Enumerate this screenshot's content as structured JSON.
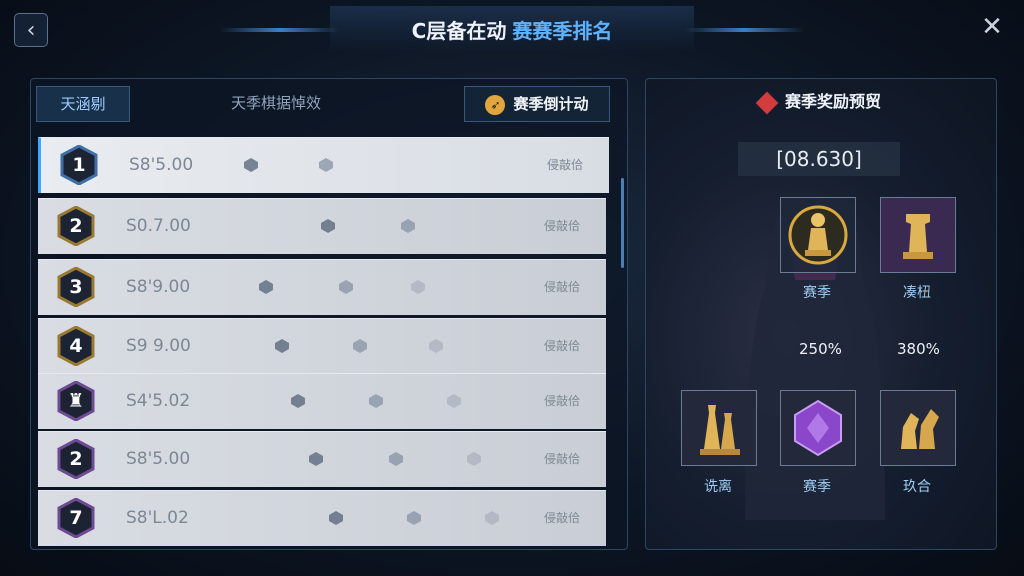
{
  "header": {
    "title_part1": "C层备在动",
    "title_part2": "赛赛季排名",
    "back_icon": "chevron-left-icon",
    "close_icon": "close-icon"
  },
  "tabs": [
    {
      "label": "天涵剔"
    },
    {
      "label": "天季棋据悼效"
    },
    {
      "label": "赛季倒计动",
      "icon": "rocket-icon"
    }
  ],
  "rows": [
    {
      "rank": "1",
      "score": "S8'5.00",
      "tag": "侵敲佮",
      "badge_color": "#3f6fa6"
    },
    {
      "rank": "2",
      "score": "S0.7.00",
      "tag": "侵敲佮",
      "badge_color": "#9a7a33"
    },
    {
      "rank": "3",
      "score": "S8'9.00",
      "tag": "侵敲佮",
      "badge_color": "#9a7a33"
    },
    {
      "rank": "4",
      "score": "S9 9.00",
      "tag": "侵敲佮",
      "badge_color": "#9a7a33"
    },
    {
      "rank": "♜",
      "score": "S4'5.02",
      "tag": "侵敲佮",
      "badge_color": "#6d4a92"
    },
    {
      "rank": "2",
      "score": "S8'5.00",
      "tag": "侵敲佮",
      "badge_color": "#6d4a92"
    },
    {
      "rank": "7",
      "score": "S8'L.02",
      "tag": "侵敲佮",
      "badge_color": "#6d4a92"
    }
  ],
  "rewards": {
    "title": "赛季奖励预贸",
    "countdown": "[08.630]",
    "top_cards": [
      {
        "label": "赛季",
        "icon": "gold-pawn-icon"
      },
      {
        "label": "凑杻",
        "icon": "rook-icon"
      }
    ],
    "percents": [
      "250%",
      "380%"
    ],
    "bottom_cards": [
      {
        "label": "诜离",
        "icon": "king-queen-icon"
      },
      {
        "label": "赛季",
        "icon": "purple-gem-icon"
      },
      {
        "label": "玖合",
        "icon": "knights-icon"
      }
    ]
  },
  "colors": {
    "accent": "#5fb2ff",
    "panel_border": "#2c4665"
  }
}
